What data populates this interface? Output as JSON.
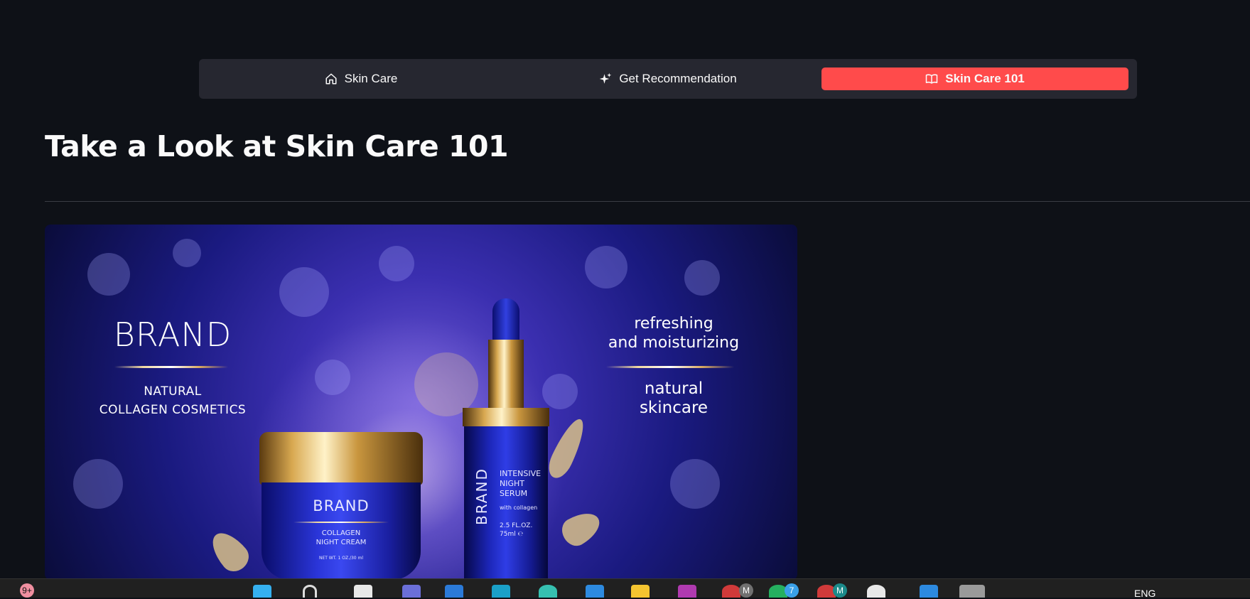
{
  "nav": {
    "items": [
      {
        "label": "Skin Care",
        "icon": "home-icon"
      },
      {
        "label": "Get Recommendation",
        "icon": "sparkles-icon"
      },
      {
        "label": "Skin Care 101",
        "icon": "book-icon",
        "active": true
      }
    ],
    "active_color": "#ff4b4b"
  },
  "page": {
    "title": "Take a Look at Skin Care 101"
  },
  "hero": {
    "brand": "BRAND",
    "subtitle_line1": "NATURAL",
    "subtitle_line2": "COLLAGEN COSMETICS",
    "right_line1": "refreshing",
    "right_line2": "and moisturizing",
    "right_line3": "natural",
    "right_line4": "skincare",
    "jar_brand": "BRAND",
    "jar_line1": "COLLAGEN",
    "jar_line2": "NIGHT CREAM",
    "jar_weight": "NET WT. 1 OZ./30 ml",
    "bottle_brand": "BRAND",
    "bottle_line1": "INTENSIVE",
    "bottle_line2": "NIGHT",
    "bottle_line3": "SERUM",
    "bottle_line4": "with collagen",
    "bottle_line5": "2.5 FL.OZ.",
    "bottle_line6": "75ml ℮"
  },
  "taskbar": {
    "notification_badge": "9+",
    "badge_7": "7",
    "avatar_m1": "M",
    "avatar_m2": "M",
    "language": "ENG"
  }
}
